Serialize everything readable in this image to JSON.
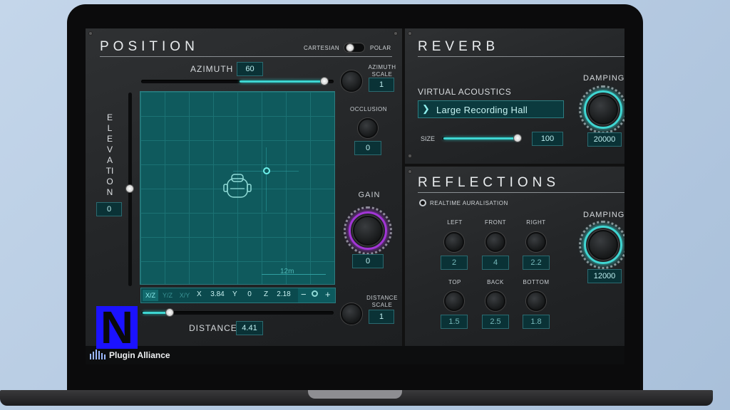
{
  "position": {
    "title": "POSITION",
    "toggle_left": "CARTESIAN",
    "toggle_right": "POLAR",
    "azimuth_label": "AZIMUTH",
    "azimuth_value": "60",
    "azimuth_scale_label": "AZIMUTH SCALE",
    "azimuth_scale_value": "1",
    "occlusion_label": "OCCLUSION",
    "occlusion_value": "0",
    "elevation_label": "ELEVATION",
    "elevation_value": "0",
    "gain_label": "GAIN",
    "gain_value": "0",
    "distance_label": "DISTANCE",
    "distance_value": "4.41",
    "distance_scale_label": "DISTANCE SCALE",
    "distance_scale_value": "1",
    "grid_scale": "12m",
    "views": [
      "X/Z",
      "Y/Z",
      "X/Y"
    ],
    "x_label": "X",
    "x_value": "3.84",
    "y_label": "Y",
    "y_value": "0",
    "z_label": "Z",
    "z_value": "2.18",
    "zoom_out": "−",
    "zoom_in": "+"
  },
  "reverb": {
    "title": "REVERB",
    "virtual_acoustics_label": "VIRTUAL ACOUSTICS",
    "room_preset": "Large Recording Hall",
    "size_label": "SIZE",
    "size_value": "100",
    "damping_label": "DAMPING",
    "damping_value": "20000"
  },
  "reflections": {
    "title": "REFLECTIONS",
    "realtime_label": "REALTIME AURALISATION",
    "damping_label": "DAMPING",
    "damping_value": "12000",
    "walls": [
      {
        "label": "LEFT",
        "value": "2"
      },
      {
        "label": "FRONT",
        "value": "4"
      },
      {
        "label": "RIGHT",
        "value": "2.2"
      },
      {
        "label": "TOP",
        "value": "1.5"
      },
      {
        "label": "BACK",
        "value": "2.5"
      },
      {
        "label": "BOTTOM",
        "value": "1.8"
      }
    ]
  },
  "brand": {
    "name": "Plugin Alliance",
    "logo_letter": "N"
  },
  "colors": {
    "accent": "#3fd6d2",
    "gain_ring": "#a236d6",
    "overlay_logo": "#1b12ff"
  }
}
